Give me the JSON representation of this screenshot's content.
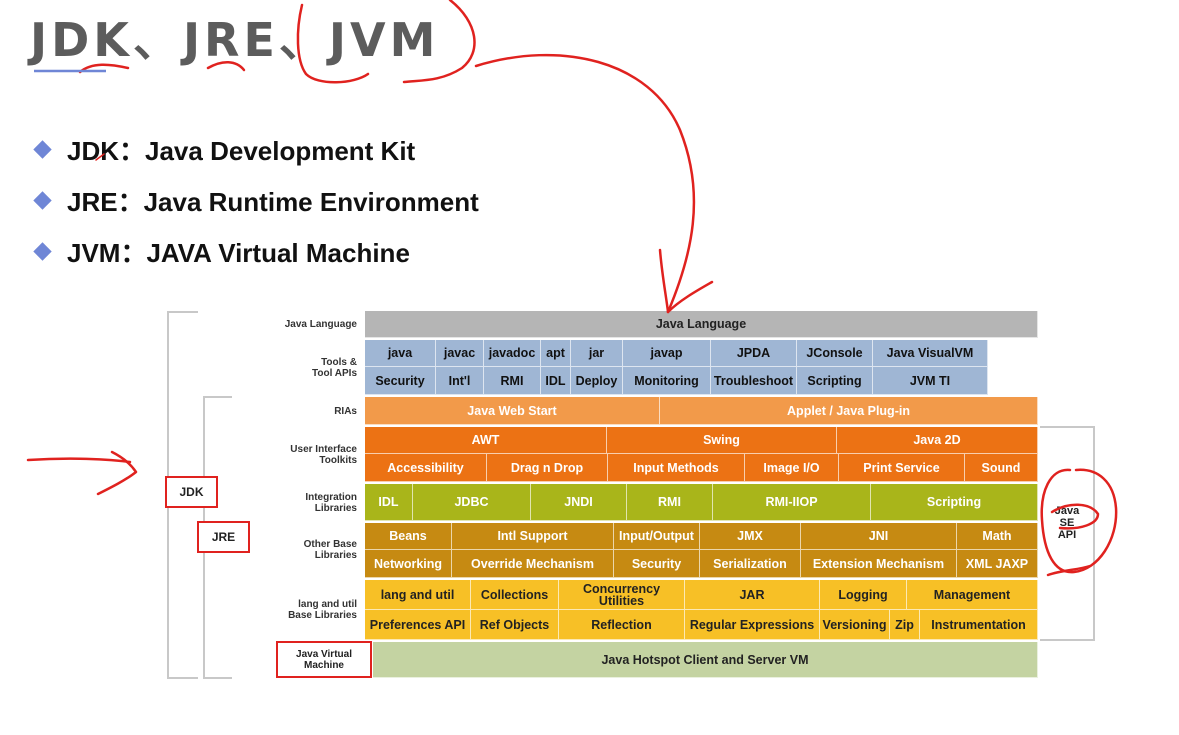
{
  "title": "JDK、JRE、JVM",
  "bullets": [
    {
      "label": "JDK：Java Development Kit"
    },
    {
      "label": "JRE：Java Runtime Environment"
    },
    {
      "label": "JVM：JAVA Virtual Machine"
    }
  ],
  "diagram": {
    "row_labels": {
      "java_language": "Java Language",
      "tools": [
        "Tools &",
        "Tool APIs"
      ],
      "rias": "RIAs",
      "ui": [
        "User Interface",
        "Toolkits"
      ],
      "integration": [
        "Integration",
        "Libraries"
      ],
      "other_base": [
        "Other Base",
        "Libraries"
      ],
      "lang_util": [
        "lang and util",
        "Base Libraries"
      ],
      "jvm": [
        "Java Virtual",
        "Machine"
      ]
    },
    "rows": {
      "java_language": [
        "Java Language"
      ],
      "tools1": [
        "java",
        "javac",
        "javadoc",
        "apt",
        "jar",
        "javap",
        "JPDA",
        "JConsole",
        "Java VisualVM"
      ],
      "tools2": [
        "Security",
        "Int'l",
        "RMI",
        "IDL",
        "Deploy",
        "Monitoring",
        "Troubleshoot",
        "Scripting",
        "JVM TI"
      ],
      "rias": [
        "Java Web Start",
        "Applet / Java Plug-in"
      ],
      "ui1": [
        "AWT",
        "Swing",
        "Java 2D"
      ],
      "ui2": [
        "Accessibility",
        "Drag n Drop",
        "Input Methods",
        "Image I/O",
        "Print Service",
        "Sound"
      ],
      "integration": [
        "IDL",
        "JDBC",
        "JNDI",
        "RMI",
        "RMI-IIOP",
        "Scripting"
      ],
      "other1": [
        "Beans",
        "Intl Support",
        "Input/Output",
        "JMX",
        "JNI",
        "Math"
      ],
      "other2": [
        "Networking",
        "Override Mechanism",
        "Security",
        "Serialization",
        "Extension Mechanism",
        "XML JAXP"
      ],
      "lang1": [
        "lang and util",
        "Collections",
        "Concurrency Utilities",
        "JAR",
        "Logging",
        "Management"
      ],
      "lang2": [
        "Preferences API",
        "Ref Objects",
        "Reflection",
        "Regular Expressions",
        "Versioning",
        "Zip",
        "Instrumentation"
      ],
      "jvm": [
        "Java Hotspot Client and Server VM"
      ]
    },
    "boxes": {
      "jdk": "JDK",
      "jre": "JRE"
    },
    "java_se_api": [
      "Java",
      "SE",
      "API"
    ]
  },
  "colors": {
    "java_language": "#b5b5b5",
    "tools": "#9fb6d4",
    "rias": "#f29a4a",
    "ui": "#ec7214",
    "integration": "#a9b51a",
    "other": "#c68a12",
    "lang": "#f7c026",
    "jvm": "#c4d3a2",
    "annotation": "#e0221f"
  }
}
